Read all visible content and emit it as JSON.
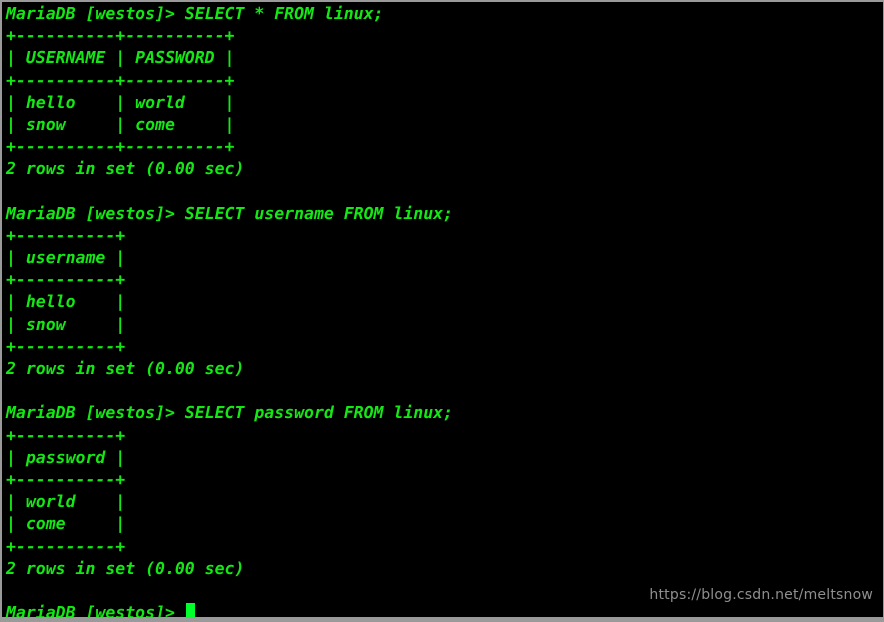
{
  "terminal": {
    "background_color": "#000000",
    "foreground_color": "#14e814",
    "border_color": "#9a9a9a",
    "cursor_color": "#00ff2a",
    "prompt": "MariaDB [westos]>",
    "blocks": [
      {
        "command_line": "MariaDB [westos]> SELECT * FROM linux;",
        "query": "SELECT * FROM linux;",
        "rule_top": "+----------+----------+",
        "header_row": "| USERNAME | PASSWORD |",
        "rule_mid": "+----------+----------+",
        "data_rows": [
          "| hello    | world    |",
          "| snow     | come     |"
        ],
        "rule_bottom": "+----------+----------+",
        "status": "2 rows in set (0.00 sec)"
      },
      {
        "command_line": "MariaDB [westos]> SELECT username FROM linux;",
        "query": "SELECT username FROM linux;",
        "rule_top": "+----------+",
        "header_row": "| username |",
        "rule_mid": "+----------+",
        "data_rows": [
          "| hello    |",
          "| snow     |"
        ],
        "rule_bottom": "+----------+",
        "status": "2 rows in set (0.00 sec)"
      },
      {
        "command_line": "MariaDB [westos]> SELECT password FROM linux;",
        "query": "SELECT password FROM linux;",
        "rule_top": "+----------+",
        "header_row": "| password |",
        "rule_mid": "+----------+",
        "data_rows": [
          "| world    |",
          "| come     |"
        ],
        "rule_bottom": "+----------+",
        "status": "2 rows in set (0.00 sec)"
      }
    ],
    "final_prompt": "MariaDB [westos]> ",
    "blank_line": " "
  },
  "watermark": {
    "text": "https://blog.csdn.net/meltsnow",
    "color": "#8f8f8f"
  },
  "tables": {
    "linux_table": {
      "columns": [
        "USERNAME",
        "PASSWORD"
      ],
      "rows": [
        [
          "hello",
          "world"
        ],
        [
          "snow",
          "come"
        ]
      ],
      "row_count": 2
    }
  }
}
